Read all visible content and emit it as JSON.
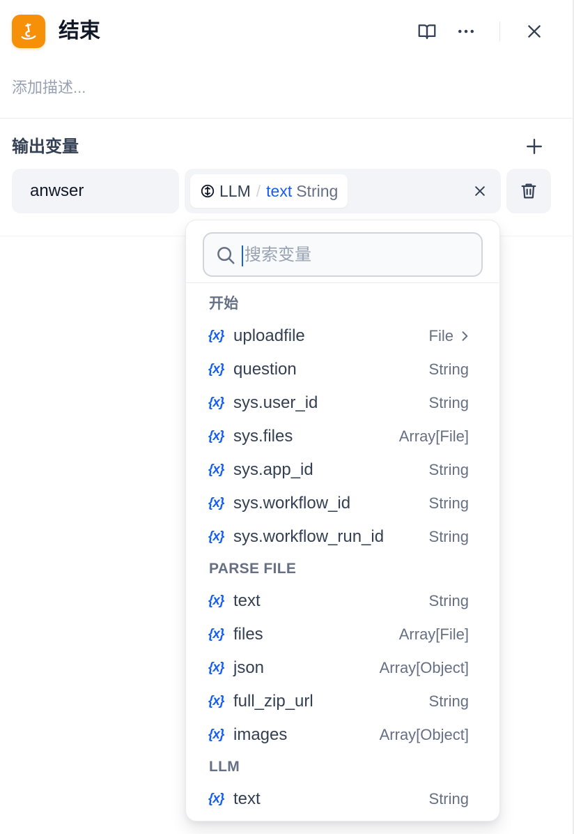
{
  "header": {
    "title": "结束",
    "description_placeholder": "添加描述..."
  },
  "output_section": {
    "title": "输出变量",
    "variable_name": "anwser",
    "selected": {
      "node": "LLM",
      "variable": "text",
      "type": "String"
    }
  },
  "dropdown": {
    "search_placeholder": "搜索变量",
    "groups": [
      {
        "title": "开始",
        "items": [
          {
            "name": "uploadfile",
            "type": "File",
            "has_children": true
          },
          {
            "name": "question",
            "type": "String"
          },
          {
            "name": "sys.user_id",
            "type": "String"
          },
          {
            "name": "sys.files",
            "type": "Array[File]"
          },
          {
            "name": "sys.app_id",
            "type": "String"
          },
          {
            "name": "sys.workflow_id",
            "type": "String"
          },
          {
            "name": "sys.workflow_run_id",
            "type": "String"
          }
        ]
      },
      {
        "title": "PARSE FILE",
        "items": [
          {
            "name": "text",
            "type": "String"
          },
          {
            "name": "files",
            "type": "Array[File]"
          },
          {
            "name": "json",
            "type": "Array[Object]"
          },
          {
            "name": "full_zip_url",
            "type": "String"
          },
          {
            "name": "images",
            "type": "Array[Object]"
          }
        ]
      },
      {
        "title": "LLM",
        "items": [
          {
            "name": "text",
            "type": "String"
          }
        ]
      }
    ]
  },
  "variable_icon_glyph": "{x}",
  "colors": {
    "accent": "#155eef",
    "node_icon_bg": "#f79009",
    "muted_text": "#667085"
  }
}
